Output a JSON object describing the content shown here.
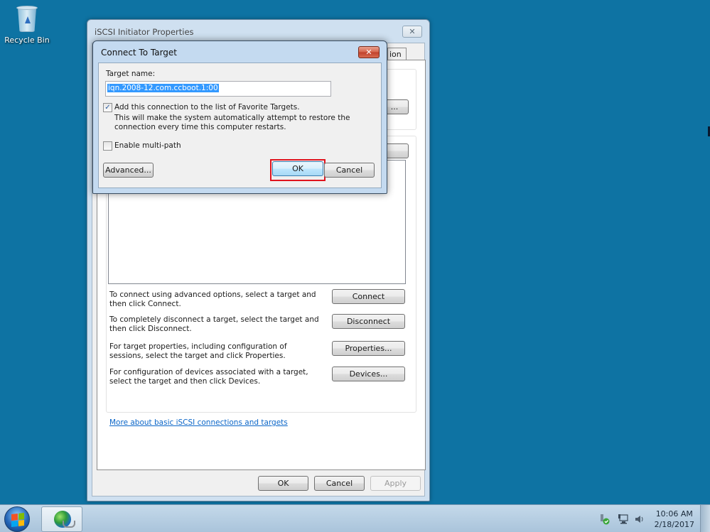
{
  "desktop": {
    "icons": [
      {
        "label": "Recycle Bin",
        "icon": "recycle-bin-icon"
      }
    ],
    "background_color": "#0e73a3"
  },
  "main_window": {
    "title": "iSCSI Initiator Properties",
    "close_icon": "close-icon",
    "visible_tab_fragment": "ion",
    "panel_actions": [
      {
        "description": "To connect using advanced options, select a target and then click Connect.",
        "button": "Connect"
      },
      {
        "description": "To completely disconnect a target, select the target and then click Disconnect.",
        "button": "Disconnect"
      },
      {
        "description": "For target properties, including configuration of sessions, select the target and click Properties.",
        "button": "Properties..."
      },
      {
        "description": "For configuration of devices associated with a target, select the target and then click Devices.",
        "button": "Devices..."
      }
    ],
    "help_link": "More about basic iSCSI connections and targets",
    "footer_buttons": {
      "ok": "OK",
      "cancel": "Cancel",
      "apply": "Apply"
    },
    "partially_hidden_button_fragment": "..."
  },
  "connect_dialog": {
    "title": "Connect To Target",
    "close_icon": "close-icon",
    "target_name_label": "Target name:",
    "target_name_value": "iqn.2008-12.com.ccboot.1:00",
    "favorite_checkbox": {
      "label": "Add this connection to the list of Favorite Targets.",
      "checked": true,
      "description_line1": "This will make the system automatically attempt to restore the",
      "description_line2": "connection every time this computer restarts."
    },
    "multipath_checkbox": {
      "label": "Enable multi-path",
      "checked": false
    },
    "advanced_button": "Advanced...",
    "ok_button": "OK",
    "cancel_button": "Cancel",
    "highlight_color": "#e0141e"
  },
  "taskbar": {
    "start_icon": "windows-start-icon",
    "pinned": [
      {
        "icon": "network-globe-icon",
        "active": true
      }
    ],
    "tray_icons": [
      "usb-device-ok-icon",
      "network-icon",
      "volume-icon"
    ],
    "clock": {
      "time": "10:06 AM",
      "date": "2/18/2017"
    }
  }
}
